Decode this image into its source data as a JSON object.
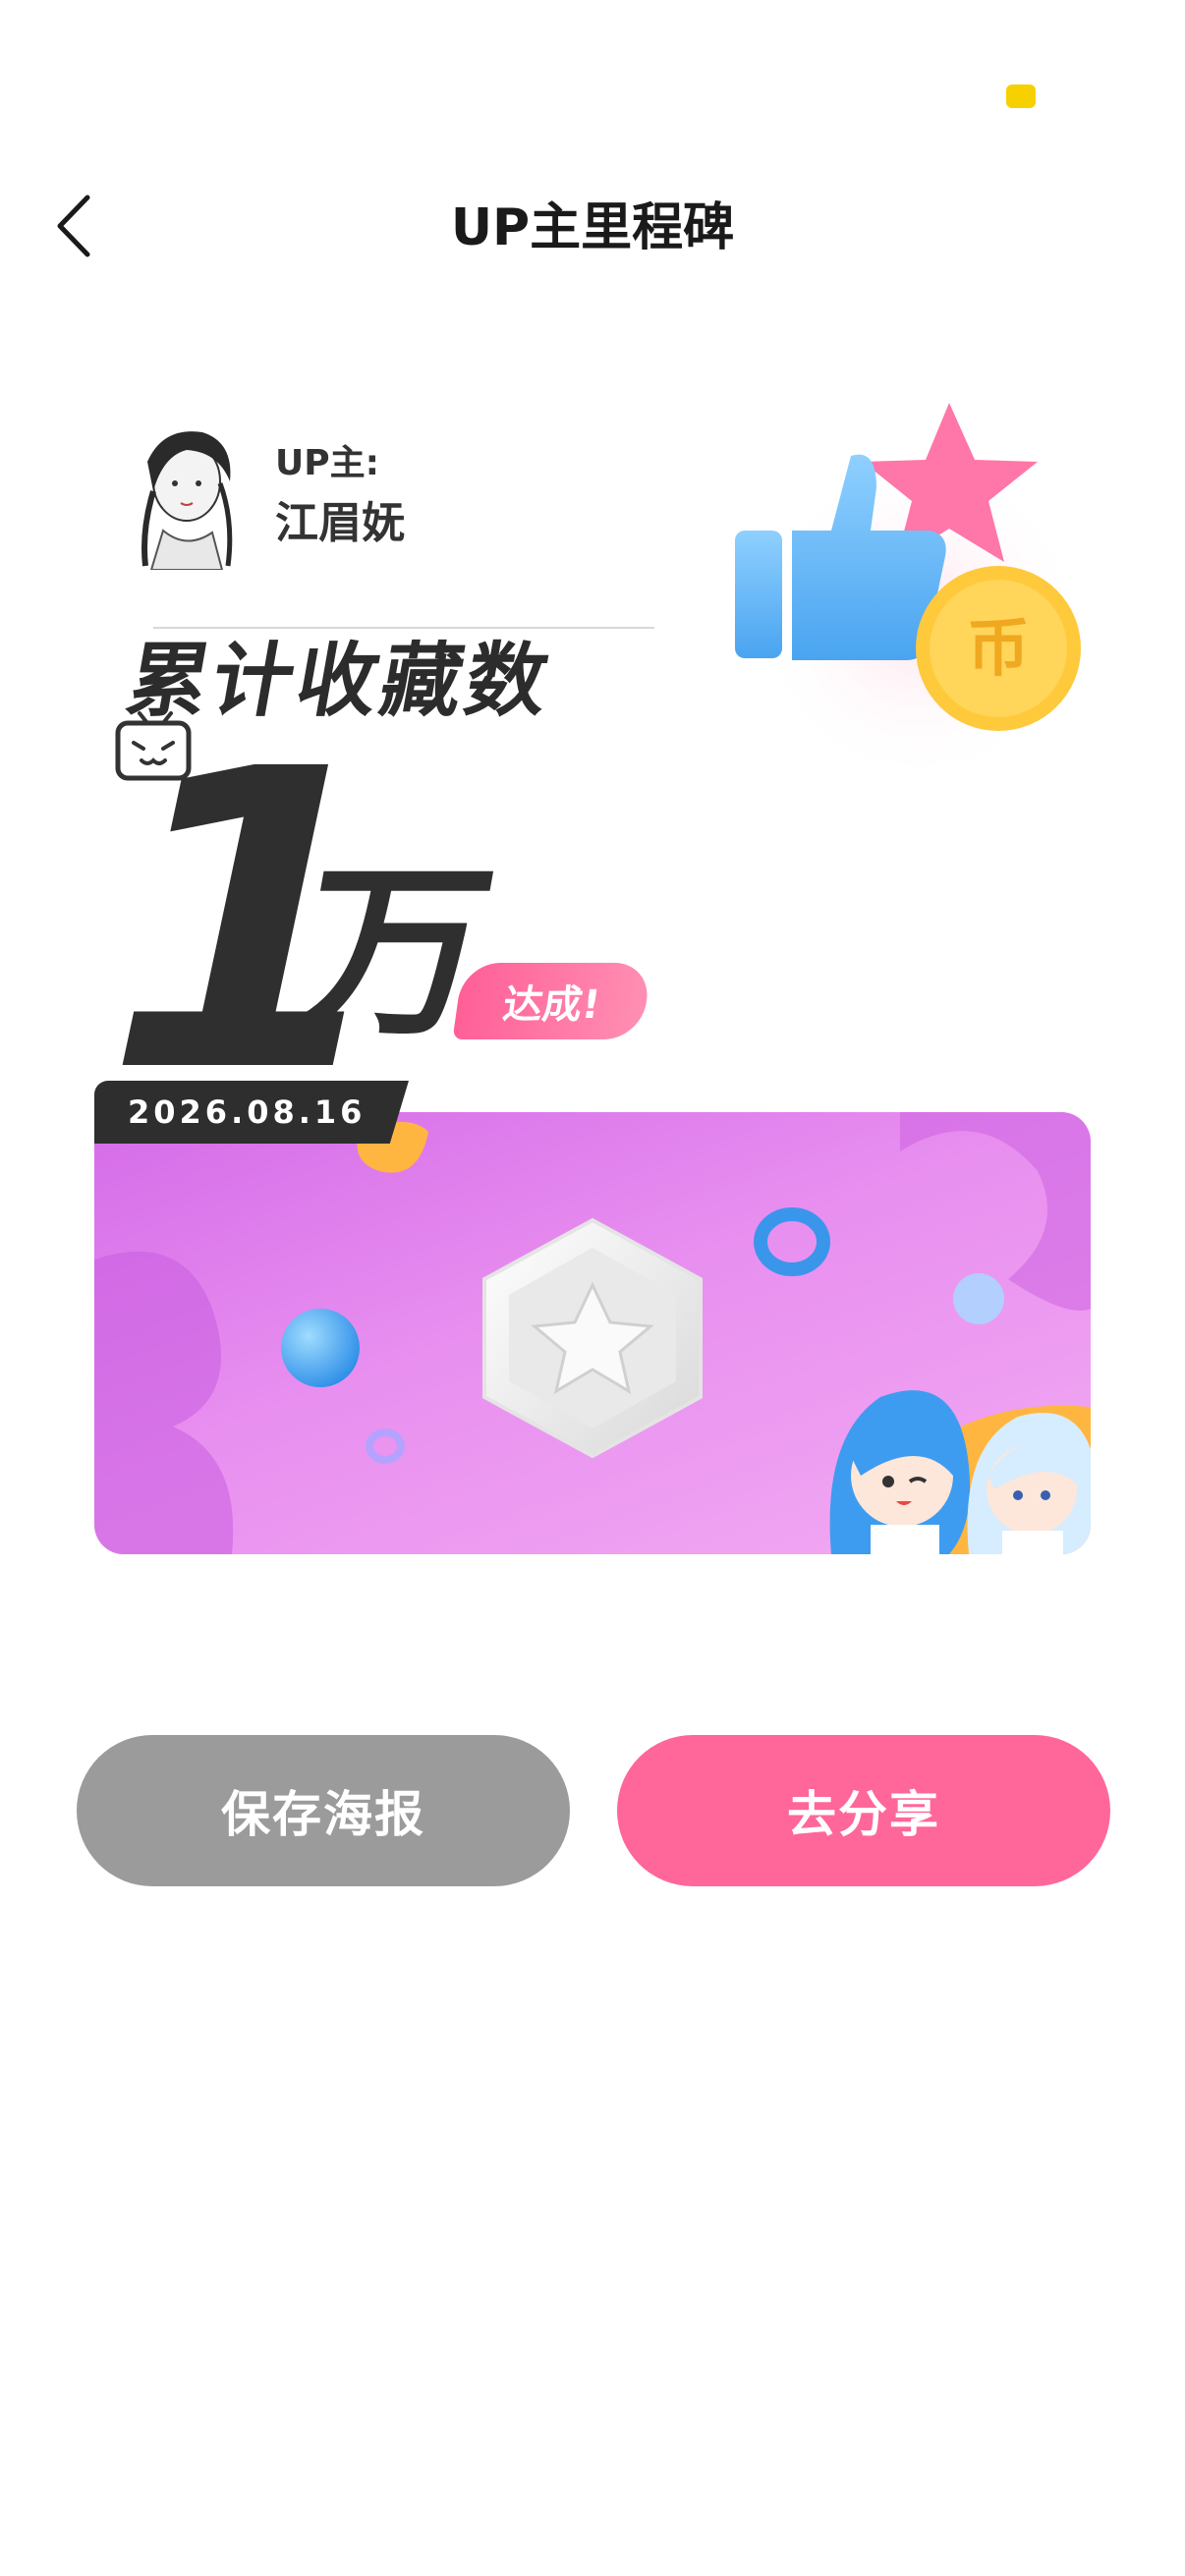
{
  "status_bar": {
    "indicator_color": "#f7d000"
  },
  "nav": {
    "back_icon": "chevron-left-icon",
    "title": "UP主里程碑"
  },
  "poster": {
    "up_label": "UP主:",
    "up_name": "江眉妩",
    "metric_title": "累计收藏数",
    "big_number": "1",
    "big_unit": "万",
    "achieved_label": "达成!",
    "date": "2026.08.16",
    "coin_label": "币",
    "colors": {
      "accent_pink": "#ff6699",
      "banner_start": "#d46be8",
      "banner_end": "#f2aaf2",
      "coin": "#ffc93c"
    }
  },
  "actions": {
    "save_label": "保存海报",
    "share_label": "去分享"
  }
}
